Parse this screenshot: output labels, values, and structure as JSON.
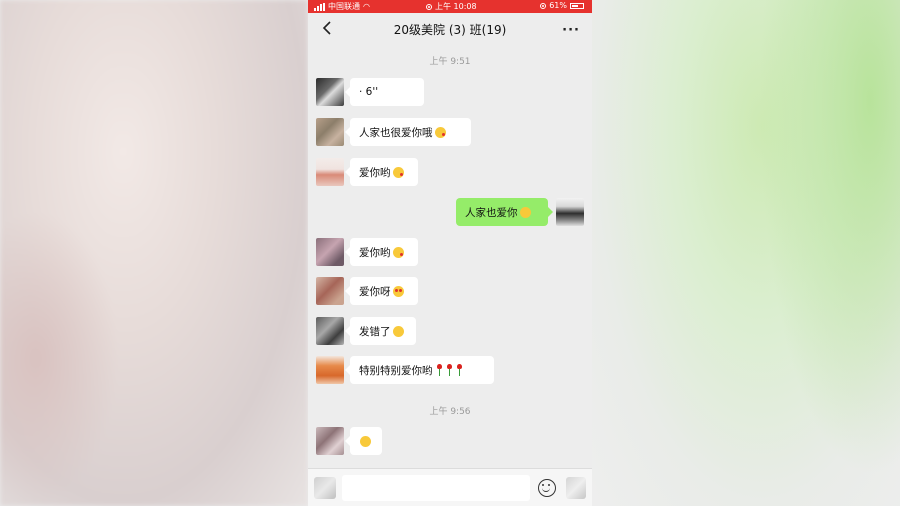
{
  "status_bar": {
    "carrier": "中国联通",
    "time": "上午 10:08",
    "battery": "61%",
    "battery_level": 0.61
  },
  "nav": {
    "back_icon": "chevron-left-icon",
    "title": "20级美院 (3) 班(19)",
    "more_icon": "more-dots-icon"
  },
  "timestamps": [
    "上午 9:51",
    "上午 9:56"
  ],
  "messages": [
    {
      "text": "·    6''",
      "mine": false
    },
    {
      "text": "人家也很爱你哦",
      "mine": false
    },
    {
      "text": "爱你哟",
      "mine": false
    },
    {
      "text": "人家也爱你",
      "mine": true
    },
    {
      "text": "爱你哟",
      "mine": false
    },
    {
      "text": "爱你呀",
      "mine": false
    },
    {
      "text": "发错了",
      "mine": false
    },
    {
      "text": "特别特别爱你哟",
      "mine": false
    },
    {
      "text": "",
      "mine": false
    }
  ],
  "colors": {
    "status_bar": "#e6322e",
    "my_bubble": "#95ec69",
    "their_bubble": "#ffffff",
    "chat_bg": "#ededed"
  }
}
